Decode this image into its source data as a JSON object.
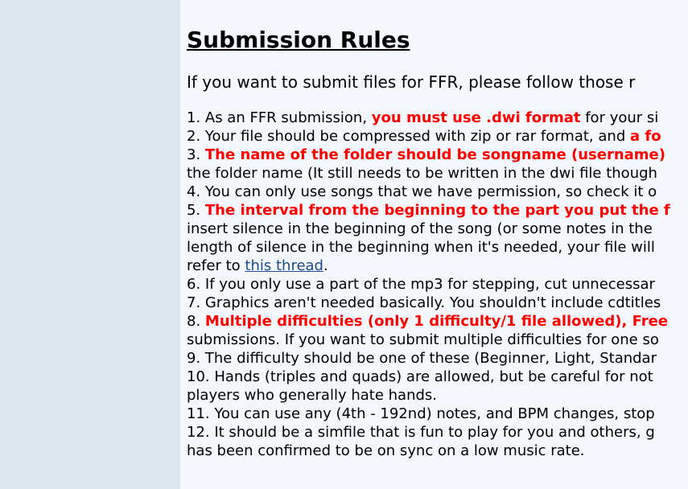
{
  "page": {
    "title": "Submission Rules",
    "intro": "If you want to submit files for FFR, please follow those r"
  },
  "rules": [
    {
      "segments": [
        {
          "text": "1. As an FFR submission, ",
          "style": "plain"
        },
        {
          "text": "you must use .dwi format",
          "style": "red"
        },
        {
          "text": " for your si",
          "style": "plain"
        }
      ]
    },
    {
      "segments": [
        {
          "text": "2. Your file should be compressed with zip or rar format, and ",
          "style": "plain"
        },
        {
          "text": "a fo",
          "style": "red"
        }
      ]
    },
    {
      "segments": [
        {
          "text": "3. ",
          "style": "plain"
        },
        {
          "text": "The name of the folder should be songname (username)",
          "style": "red"
        }
      ]
    },
    {
      "segments": [
        {
          "text": "the folder name (It still needs to be written in the dwi file though",
          "style": "plain"
        }
      ]
    },
    {
      "segments": [
        {
          "text": "4. You can only use songs that we have permission, so check it o",
          "style": "plain"
        }
      ]
    },
    {
      "segments": [
        {
          "text": "5. ",
          "style": "plain"
        },
        {
          "text": "The interval from the beginning to the part you put the f",
          "style": "red"
        }
      ]
    },
    {
      "segments": [
        {
          "text": "insert silence in the beginning of the song (or some notes in the",
          "style": "plain"
        }
      ]
    },
    {
      "segments": [
        {
          "text": "length of silence in the beginning when it's needed, your file will",
          "style": "plain"
        }
      ]
    },
    {
      "segments": [
        {
          "text": "refer to ",
          "style": "plain"
        },
        {
          "text": "this thread",
          "style": "link"
        },
        {
          "text": ".",
          "style": "plain"
        }
      ]
    },
    {
      "segments": [
        {
          "text": "6. If you only use a part of the mp3 for stepping, cut unnecessar",
          "style": "plain"
        }
      ]
    },
    {
      "segments": [
        {
          "text": "7. Graphics aren't needed basically. You shouldn't include cdtitles",
          "style": "plain"
        }
      ]
    },
    {
      "segments": [
        {
          "text": "8. ",
          "style": "plain"
        },
        {
          "text": "Multiple difficulties (only 1 difficulty/1 file allowed), Free",
          "style": "red"
        }
      ]
    },
    {
      "segments": [
        {
          "text": "submissions. If you want to submit multiple difficulties for one so",
          "style": "plain"
        }
      ]
    },
    {
      "segments": [
        {
          "text": "9. The difficulty should be one of these (Beginner, Light, Standar",
          "style": "plain"
        }
      ]
    },
    {
      "segments": [
        {
          "text": "10. Hands (triples and quads) are allowed, but be careful for not",
          "style": "plain"
        }
      ]
    },
    {
      "segments": [
        {
          "text": "players who generally hate hands.",
          "style": "plain"
        }
      ]
    },
    {
      "segments": [
        {
          "text": "11. You can use any (4th - 192nd) notes, and BPM changes, stop",
          "style": "plain"
        }
      ]
    },
    {
      "segments": [
        {
          "text": "12. It should be a simfile that is fun to play for you and others, g",
          "style": "plain"
        }
      ]
    },
    {
      "segments": [
        {
          "text": "has been confirmed to be on sync on a low music rate.",
          "style": "plain"
        }
      ]
    }
  ]
}
